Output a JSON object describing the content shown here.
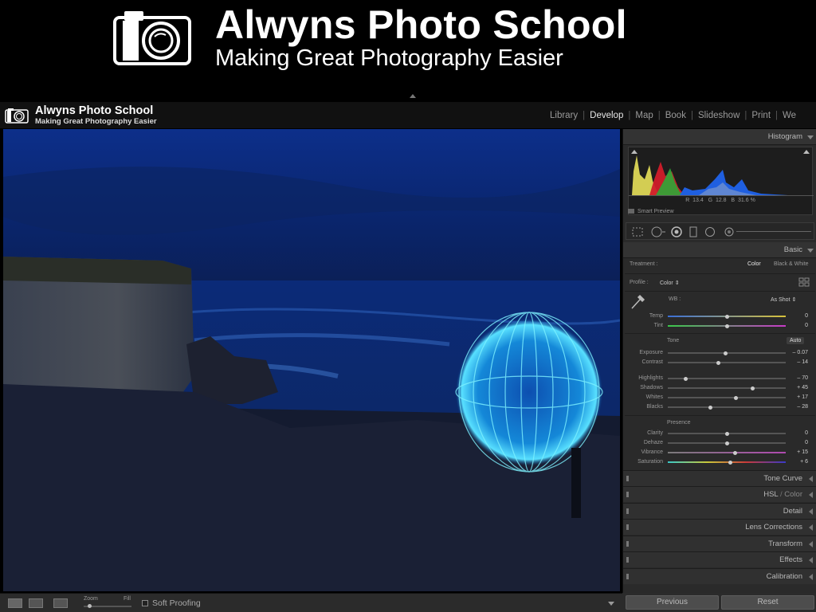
{
  "banner": {
    "title": "Alwyns Photo School",
    "subtitle": "Making Great Photography Easier"
  },
  "lightroom": {
    "brand_title": "Alwyns Photo School",
    "brand_subtitle": "Making Great Photography Easier",
    "modules": [
      "Library",
      "Develop",
      "Map",
      "Book",
      "Slideshow",
      "Print",
      "We"
    ],
    "active_module": "Develop"
  },
  "panel": {
    "histogram": {
      "label": "Histogram",
      "r_label": "R",
      "r_value": "13.4",
      "g_label": "G",
      "g_value": "12.8",
      "b_label": "B",
      "b_value": "31.6",
      "unit": "%",
      "smart_preview": "Smart Preview"
    },
    "basic": {
      "label": "Basic",
      "treatment_label": "Treatment :",
      "treatment_color": "Color",
      "treatment_bw": "Black & White",
      "profile_label": "Profile :",
      "profile_value": "Color",
      "wb_label": "WB :",
      "wb_value": "As Shot",
      "temp_label": "Temp",
      "temp_value": "0",
      "temp_level": 0.5,
      "tint_label": "Tint",
      "tint_value": "0",
      "tint_level": 0.5,
      "tone_label": "Tone",
      "auto_label": "Auto",
      "exposure_label": "Exposure",
      "exposure_value": "– 0.07",
      "exposure_level": 0.49,
      "contrast_label": "Contrast",
      "contrast_value": "– 14",
      "contrast_level": 0.43,
      "highlights_label": "Highlights",
      "highlights_value": "– 70",
      "highlights_level": 0.15,
      "shadows_label": "Shadows",
      "shadows_value": "+ 45",
      "shadows_level": 0.72,
      "whites_label": "Whites",
      "whites_value": "+ 17",
      "whites_level": 0.58,
      "blacks_label": "Blacks",
      "blacks_value": "– 28",
      "blacks_level": 0.36,
      "presence_label": "Presence",
      "clarity_label": "Clarity",
      "clarity_value": "0",
      "clarity_level": 0.5,
      "dehaze_label": "Dehaze",
      "dehaze_value": "0",
      "dehaze_level": 0.5,
      "vibrance_label": "Vibrance",
      "vibrance_value": "+ 15",
      "vibrance_level": 0.57,
      "saturation_label": "Saturation",
      "saturation_value": "+ 6",
      "saturation_level": 0.53
    },
    "sections": {
      "tone_curve": "Tone Curve",
      "hsl": "HSL",
      "hsl_sep": " / ",
      "hsl_color": "Color",
      "detail": "Detail",
      "lens": "Lens Corrections",
      "transform": "Transform",
      "effects": "Effects",
      "calibration": "Calibration"
    },
    "buttons": {
      "previous": "Previous",
      "reset": "Reset"
    }
  },
  "toolbar": {
    "zoom_label": "Zoom",
    "fill_label": "Fill",
    "soft_proofing": "Soft Proofing"
  }
}
